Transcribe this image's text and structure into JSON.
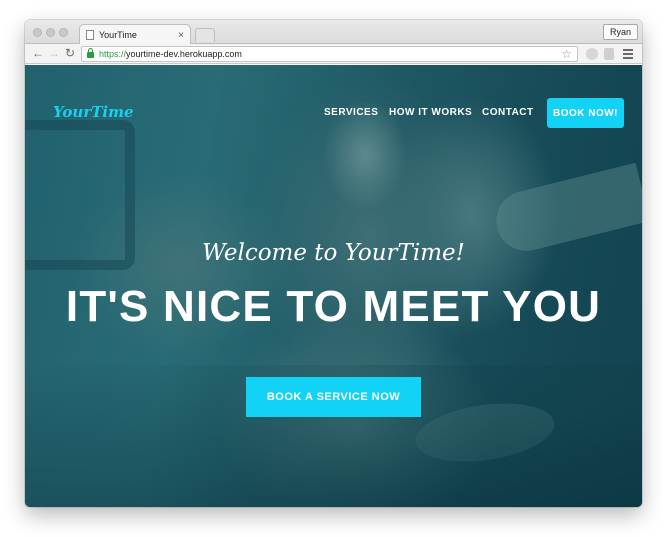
{
  "browser": {
    "tab_title": "YourTime",
    "profile_name": "Ryan",
    "url_scheme": "https://",
    "url_host": "yourtime-dev.herokuapp.com"
  },
  "site": {
    "logo": "YourTime",
    "nav": {
      "services": "SERVICES",
      "how_it_works": "HOW IT WORKS",
      "contact": "CONTACT",
      "book_now": "BOOK NOW!"
    },
    "hero": {
      "welcome": "Welcome to YourTime!",
      "headline": "IT'S NICE TO MEET YOU",
      "cta": "BOOK A SERVICE NOW"
    }
  },
  "colors": {
    "accent": "#12d2f6",
    "logo": "#16d2f0",
    "overlay": "#0a505c"
  },
  "icons": {
    "back": "arrow-left",
    "forward": "arrow-right",
    "reload": "reload",
    "secure": "lock",
    "bookmark": "star",
    "menu": "hamburger"
  }
}
